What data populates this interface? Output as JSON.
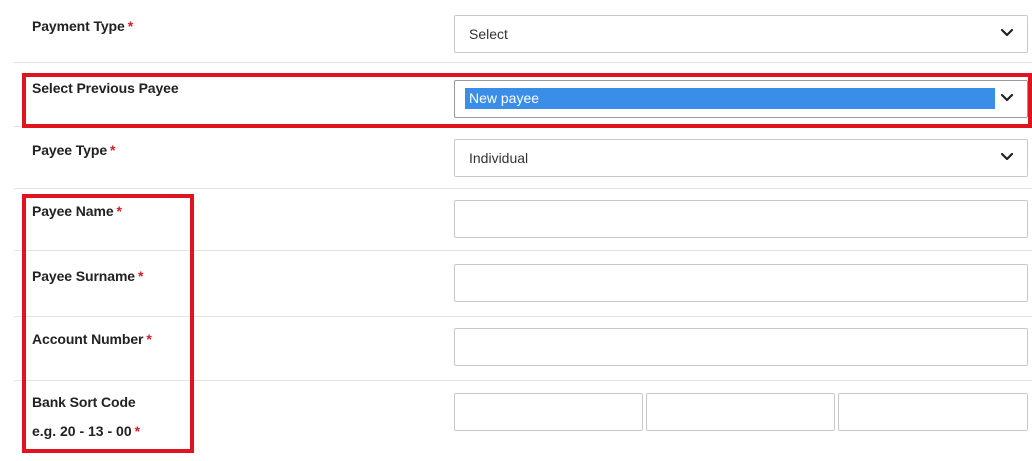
{
  "form": {
    "payment_type": {
      "label": "Payment Type",
      "required_mark": "*",
      "value": "Select"
    },
    "previous_payee": {
      "label": "Select Previous Payee",
      "value": "New payee"
    },
    "payee_type": {
      "label": "Payee Type",
      "required_mark": "*",
      "value": "Individual"
    },
    "payee_name": {
      "label": "Payee Name",
      "required_mark": "*",
      "value": ""
    },
    "payee_surname": {
      "label": "Payee Surname",
      "required_mark": "*",
      "value": ""
    },
    "account_number": {
      "label": "Account Number",
      "required_mark": "*",
      "value": ""
    },
    "bank_sort_code": {
      "label": "Bank Sort Code",
      "hint": "e.g. 20 - 13 - 00",
      "required_mark": "*",
      "values": [
        "",
        "",
        ""
      ]
    }
  },
  "icons": {
    "dropdown": "chevron-down-icon"
  },
  "colors": {
    "required": "#d0202a",
    "annotation_highlight": "#e0141e",
    "selection": "#3b8ee8"
  }
}
